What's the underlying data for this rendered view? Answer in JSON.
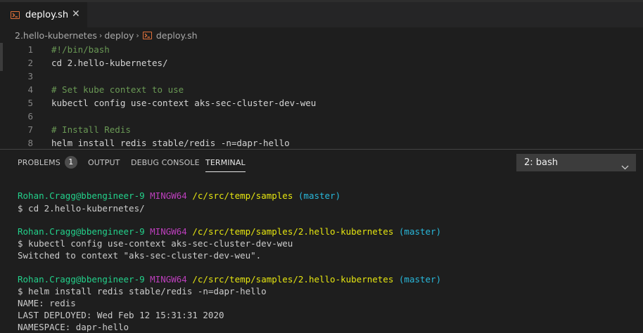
{
  "tab": {
    "label": "deploy.sh",
    "close": "✕",
    "icon": "shell-file-icon"
  },
  "breadcrumb": {
    "items": [
      "2.hello-kubernetes",
      "deploy",
      "deploy.sh"
    ],
    "sep": "›"
  },
  "editor": {
    "lines": [
      {
        "num": "1",
        "text": "#!/bin/bash",
        "kind": "comment"
      },
      {
        "num": "2",
        "text": "cd 2.hello-kubernetes/",
        "kind": "code"
      },
      {
        "num": "3",
        "text": "",
        "kind": "code"
      },
      {
        "num": "4",
        "text": "# Set kube context to use",
        "kind": "comment"
      },
      {
        "num": "5",
        "text": "kubectl config use-context aks-sec-cluster-dev-weu",
        "kind": "code"
      },
      {
        "num": "6",
        "text": "",
        "kind": "code"
      },
      {
        "num": "7",
        "text": "# Install Redis",
        "kind": "comment"
      },
      {
        "num": "8",
        "text": "helm install redis stable/redis -n=dapr-hello",
        "kind": "code"
      }
    ]
  },
  "panel": {
    "tabs": [
      "PROBLEMS",
      "OUTPUT",
      "DEBUG CONSOLE",
      "TERMINAL"
    ],
    "problems_count": "1",
    "terminal_select": "2: bash"
  },
  "terminal": {
    "prompts": [
      {
        "user": "Rohan.Cragg@bbengineer-9",
        "host": "MINGW64",
        "path": "/c/src/temp/samples",
        "branch": "(master)"
      },
      {
        "user": "Rohan.Cragg@bbengineer-9",
        "host": "MINGW64",
        "path": "/c/src/temp/samples/2.hello-kubernetes",
        "branch": "(master)"
      },
      {
        "user": "Rohan.Cragg@bbengineer-9",
        "host": "MINGW64",
        "path": "/c/src/temp/samples/2.hello-kubernetes",
        "branch": "(master)"
      }
    ],
    "commands": [
      "$ cd 2.hello-kubernetes/",
      "$ kubectl config use-context aks-sec-cluster-dev-weu",
      "$ helm install redis stable/redis -n=dapr-hello"
    ],
    "outputs": [
      "Switched to context \"aks-sec-cluster-dev-weu\".",
      "NAME: redis",
      "LAST DEPLOYED: Wed Feb 12 15:31:31 2020",
      "NAMESPACE: dapr-hello"
    ]
  },
  "colors": {
    "user": "#23d18b",
    "host": "#bc3fbc",
    "path": "#e5e510",
    "branch": "#29b8db",
    "comment": "#6a9955",
    "file_icon": "#e0703a"
  }
}
